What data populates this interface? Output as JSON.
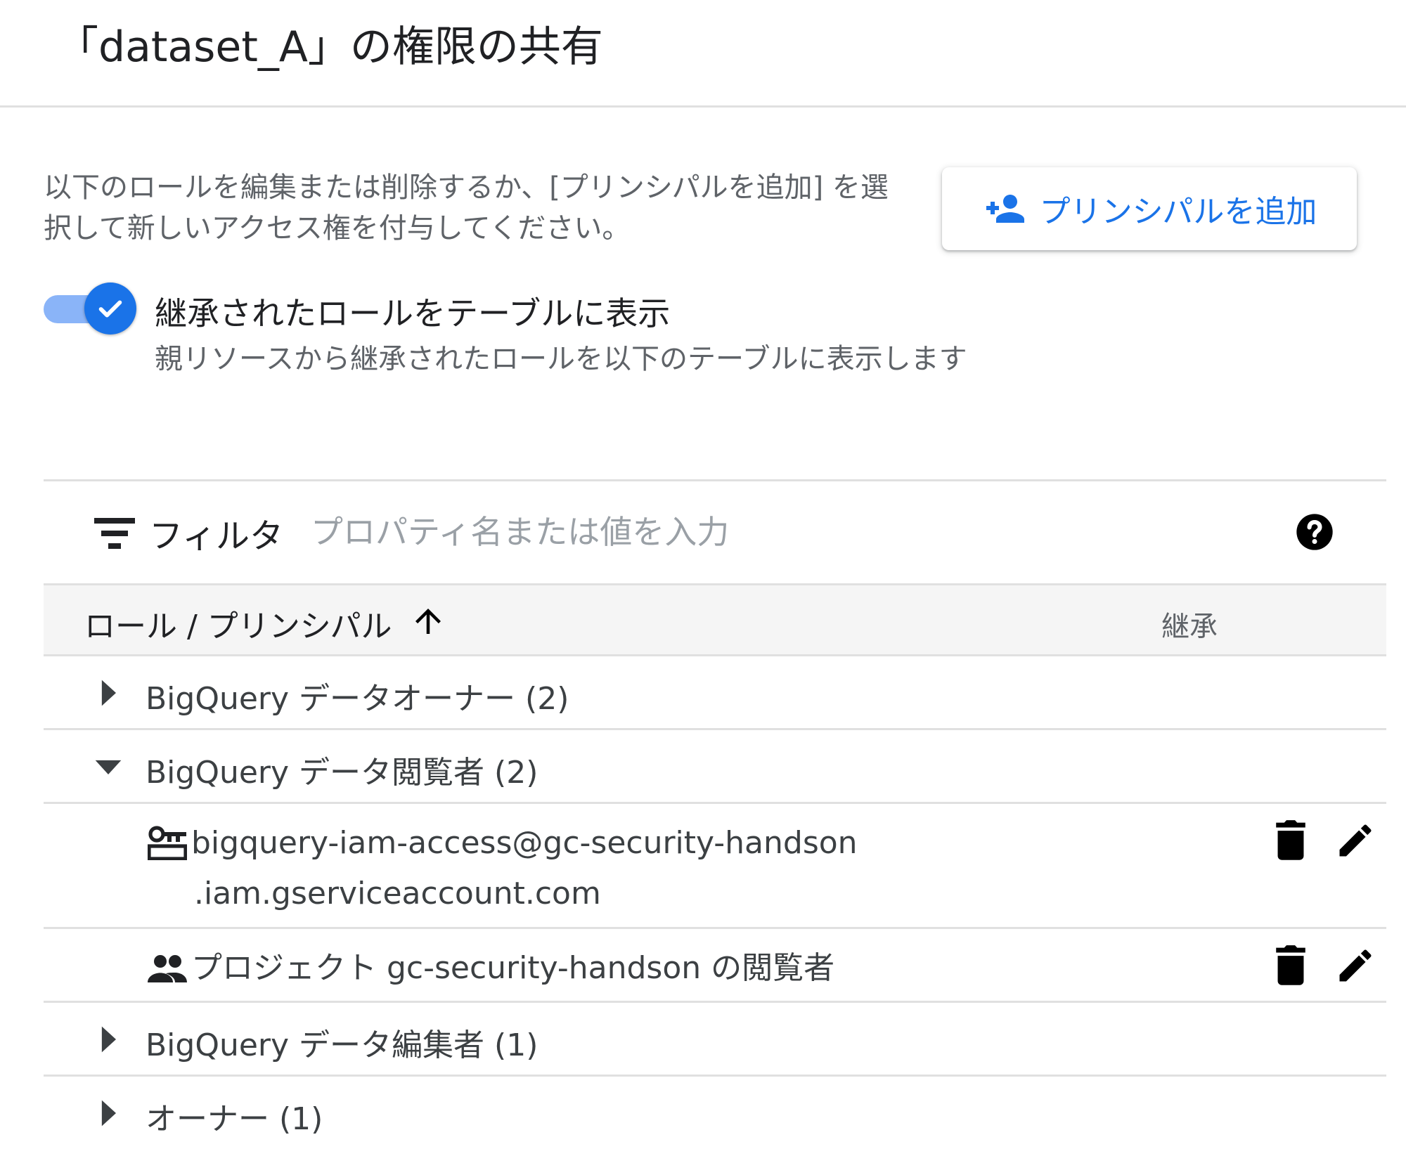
{
  "dialog": {
    "title": "「dataset_A」の権限の共有",
    "description": "以下のロールを編集または削除するか、[プリンシパルを追加] を選択して新しいアクセス権を付与してください。",
    "add_principal_label": "プリンシパルを追加"
  },
  "inherit_toggle": {
    "checked": true,
    "label": "継承されたロールをテーブルに表示",
    "description": "親リソースから継承されたロールを以下のテーブルに表示します"
  },
  "filter": {
    "label": "フィルタ",
    "placeholder": "プロパティ名または値を入力"
  },
  "table": {
    "columns": {
      "role": "ロール / プリンシパル",
      "inherit": "継承"
    },
    "sort": "ascending",
    "roles": [
      {
        "label": "BigQuery データオーナー (2)",
        "expanded": false
      },
      {
        "label": "BigQuery データ閲覧者 (2)",
        "expanded": true
      },
      {
        "label": "BigQuery データ編集者 (1)",
        "expanded": false
      },
      {
        "label": "オーナー (1)",
        "expanded": false
      }
    ],
    "members": [
      {
        "icon": "service-account-icon",
        "line1": "bigquery-iam-access@gc-security-handson",
        "line2": ".iam.gserviceaccount.com"
      },
      {
        "icon": "group-icon",
        "line1": "プロジェクト gc-security-handson の閲覧者"
      }
    ]
  },
  "colors": {
    "accent": "#1a73e8",
    "toggle_track": "#8ab4f8",
    "divider": "#e0e0e0",
    "header_bg": "#f5f5f5"
  }
}
